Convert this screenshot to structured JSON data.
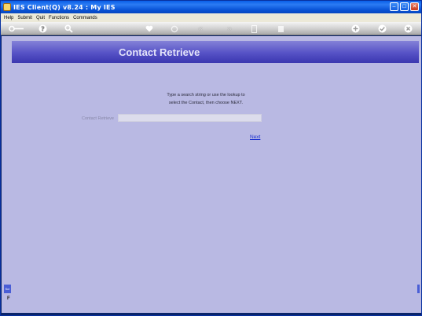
{
  "window": {
    "title": "IES Client(Q) v8.24 : My IES",
    "minimize_icon": "minimize-icon",
    "maximize_icon": "maximize-icon",
    "close_icon": "close-icon"
  },
  "menu": {
    "items": [
      "Help",
      "Submit",
      "Quit",
      "Functions",
      "Commands"
    ]
  },
  "toolbar": {
    "icons": [
      "key-icon",
      "help-icon",
      "search-icon",
      "heart-icon",
      "refresh-icon",
      "back-icon",
      "forward-icon",
      "document-icon",
      "stop-icon",
      "add-icon",
      "check-icon",
      "close-icon"
    ]
  },
  "page": {
    "banner_title": "Contact Retrieve",
    "instruction_line1": "Type a search string or use the lookup to",
    "instruction_line2": "select the Contact, then choose NEXT.",
    "field_label": "Contact Retrieve",
    "field_value": "",
    "next_label": "Next"
  },
  "side": {
    "tab_label": "Scr",
    "mark": "F"
  },
  "colors": {
    "content_bg": "#b9b9e3",
    "banner": "#5652c6",
    "link": "#1a2fd0"
  }
}
